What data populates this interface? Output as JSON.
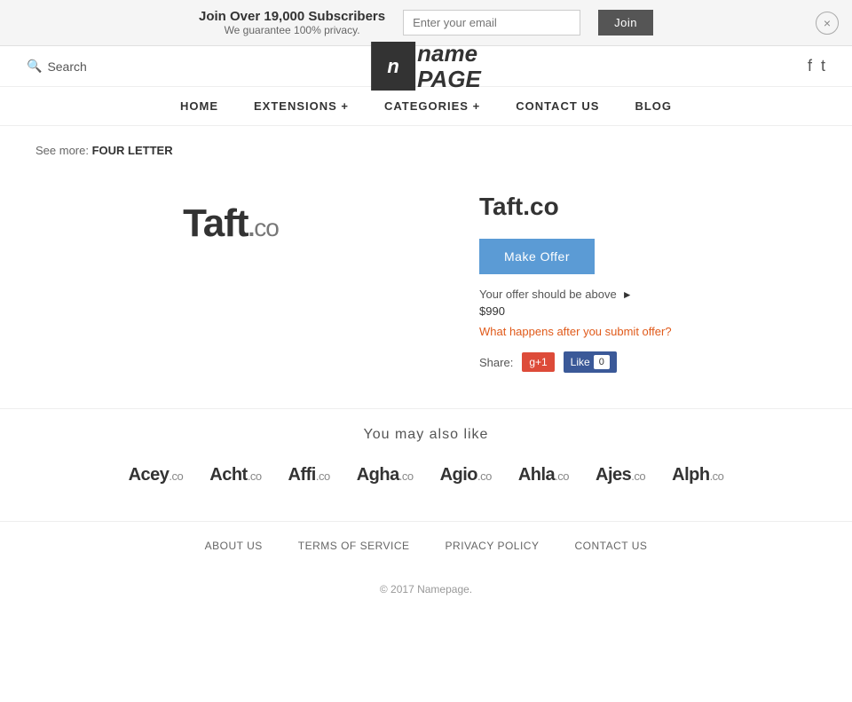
{
  "banner": {
    "headline": "Join Over 19,000 Subscribers",
    "subline": "We guarantee 100% privacy.",
    "email_placeholder": "Enter your email",
    "join_label": "Join",
    "close_label": "×"
  },
  "header": {
    "search_label": "Search",
    "logo_icon": "n",
    "logo_name": "name",
    "logo_page": "PAGE",
    "facebook_label": "f",
    "twitter_label": "t"
  },
  "nav": {
    "items": [
      {
        "label": "HOME",
        "id": "home"
      },
      {
        "label": "EXTENSIONS +",
        "id": "extensions"
      },
      {
        "label": "CATEGORIES +",
        "id": "categories"
      },
      {
        "label": "CONTACT US",
        "id": "contact"
      },
      {
        "label": "BLOG",
        "id": "blog"
      }
    ]
  },
  "breadcrumb": {
    "prefix": "See more:",
    "value": "FOUR LETTER"
  },
  "domain": {
    "name": "Taft",
    "ext": ".co",
    "full": "Taft.co",
    "make_offer_label": "Make Offer",
    "offer_hint": "Your offer should be above",
    "offer_price": "$990",
    "offer_link": "What happens after you submit offer?",
    "share_label": "Share:",
    "g1_label": "g+1",
    "fb_label": "Like",
    "fb_count": "0"
  },
  "also_like": {
    "title": "You may also like",
    "items": [
      {
        "name": "Acey",
        "ext": ".co"
      },
      {
        "name": "Acht",
        "ext": ".co"
      },
      {
        "name": "Affi",
        "ext": ".co"
      },
      {
        "name": "Agha",
        "ext": ".co"
      },
      {
        "name": "Agio",
        "ext": ".co"
      },
      {
        "name": "Ahla",
        "ext": ".co"
      },
      {
        "name": "Ajes",
        "ext": ".co"
      },
      {
        "name": "Alph",
        "ext": ".co"
      }
    ]
  },
  "footer": {
    "links": [
      {
        "label": "ABOUT US",
        "id": "about"
      },
      {
        "label": "TERMS OF SERVICE",
        "id": "terms"
      },
      {
        "label": "PRIVACY POLICY",
        "id": "privacy"
      },
      {
        "label": "CONTACT US",
        "id": "contact"
      }
    ],
    "copyright": "© 2017 Namepage."
  }
}
